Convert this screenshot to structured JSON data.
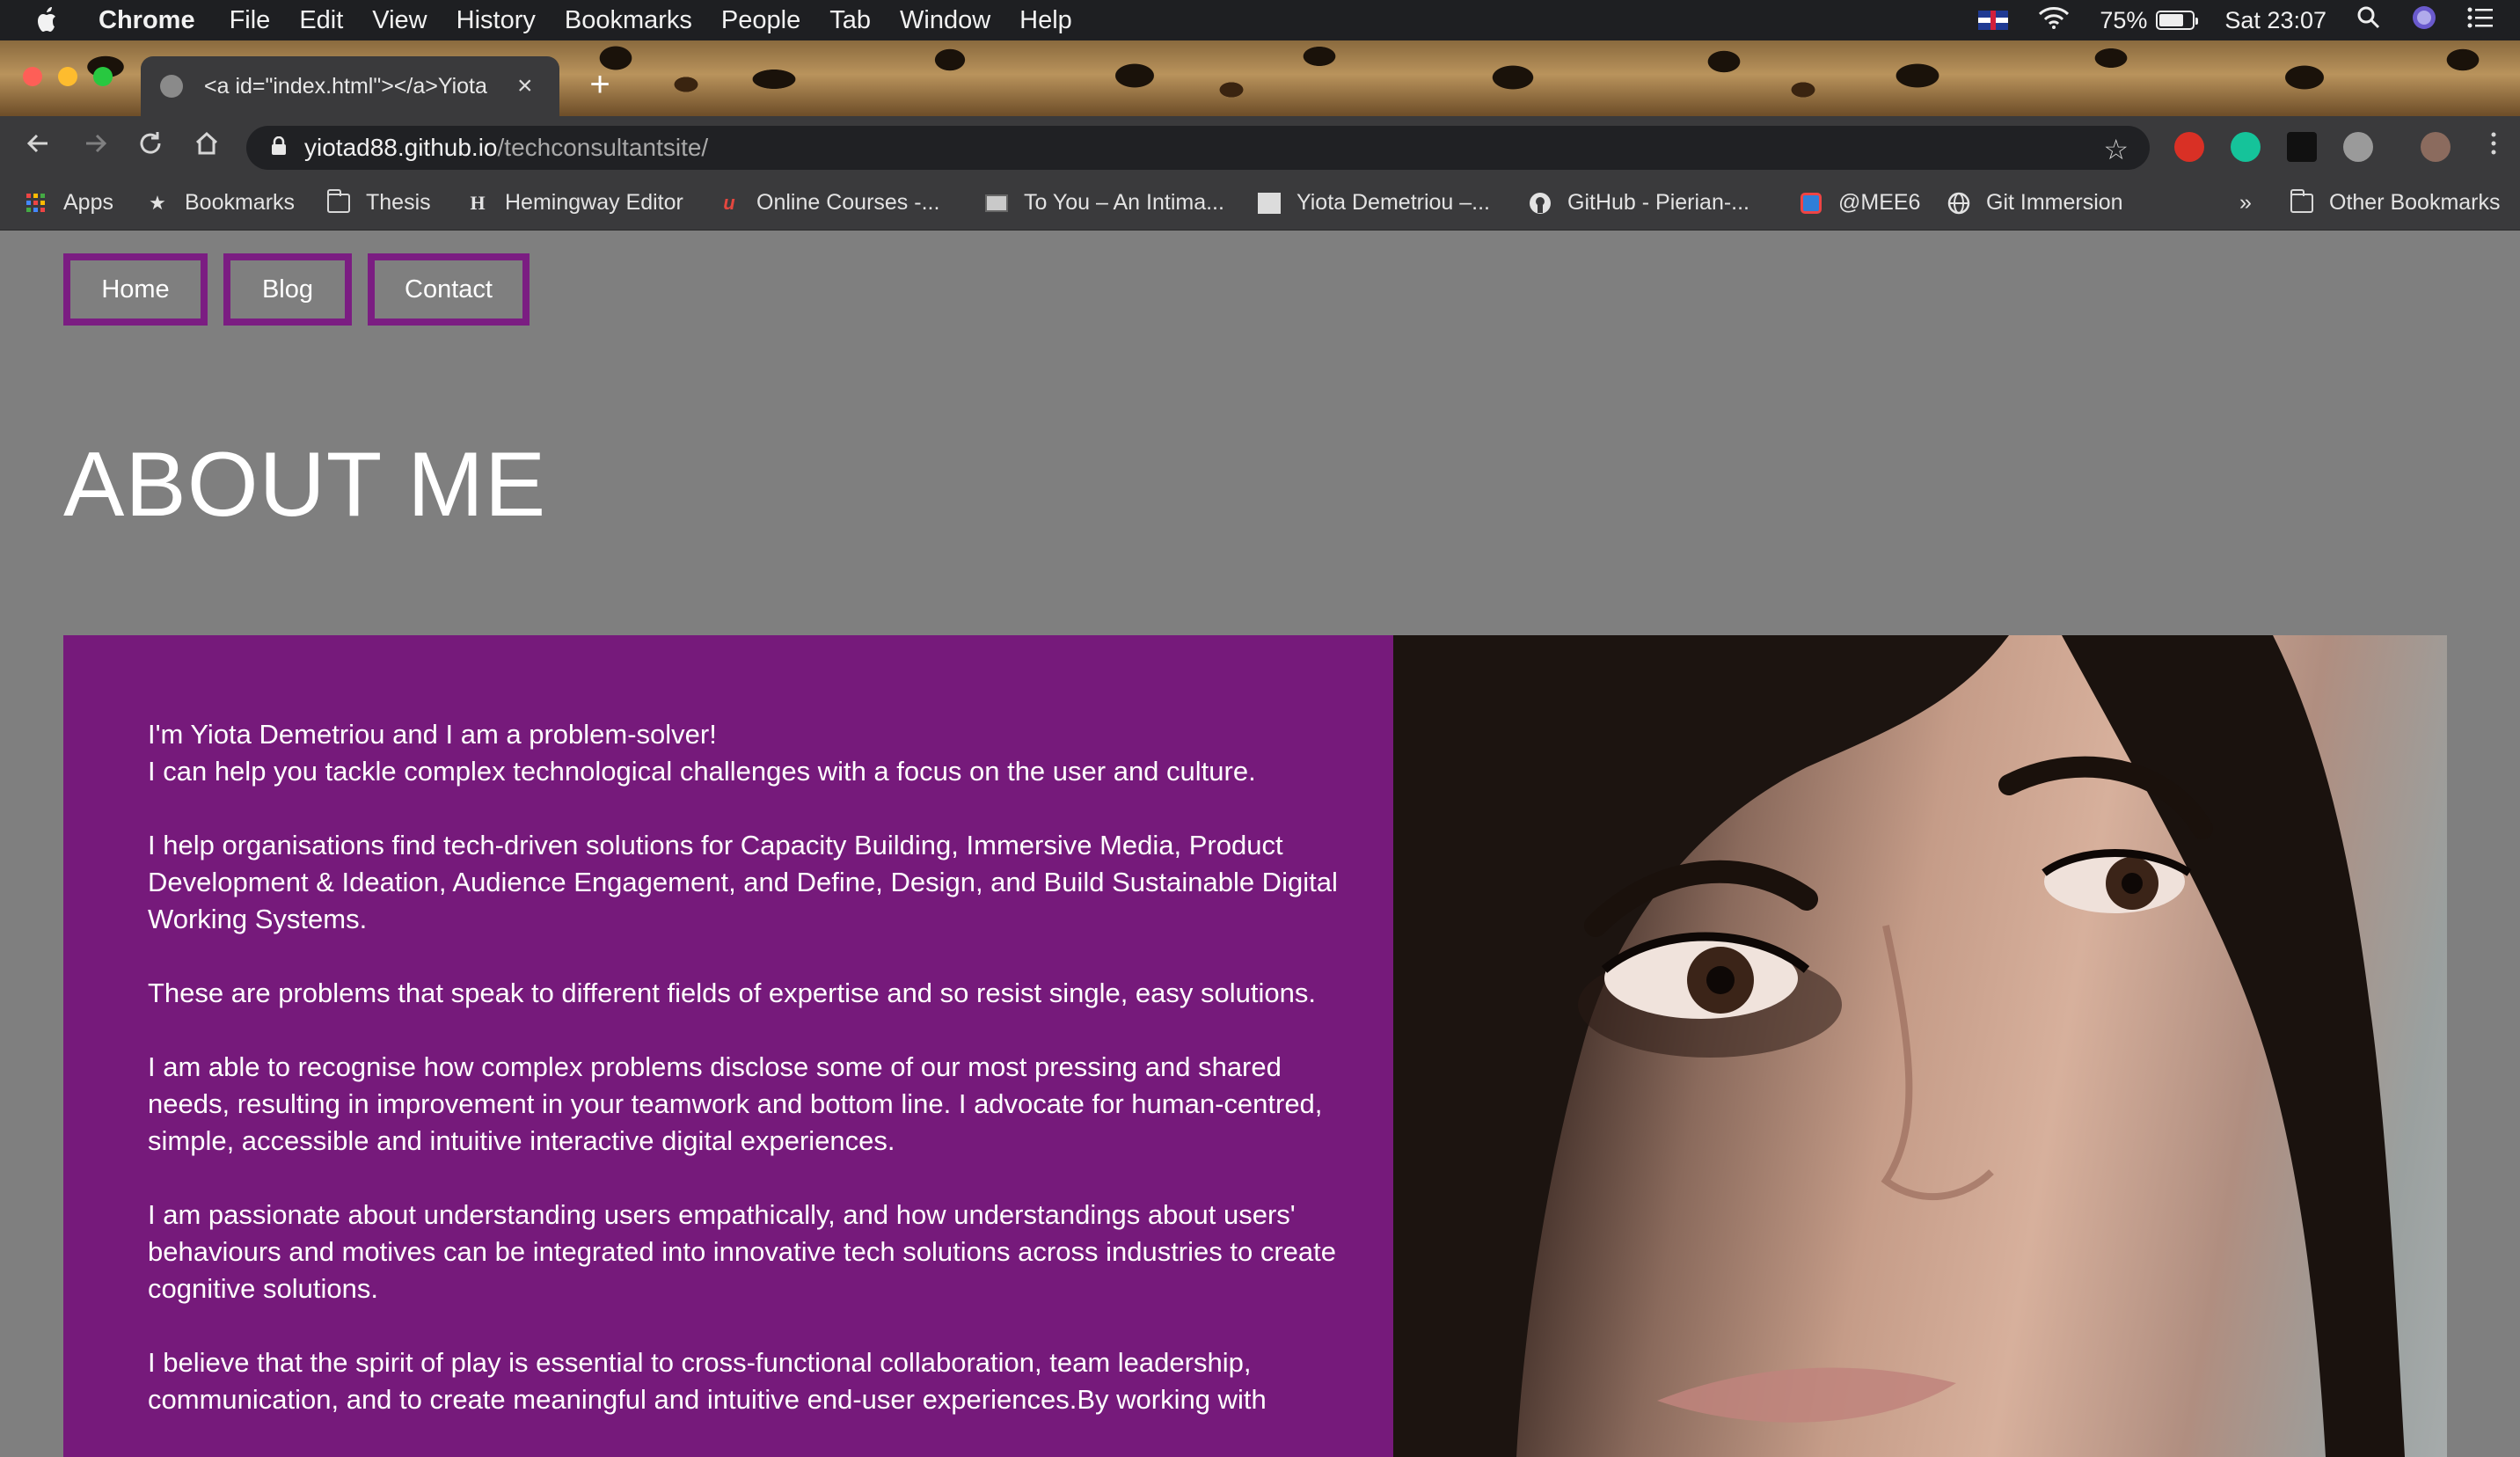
{
  "menubar": {
    "app_name": "Chrome",
    "items": [
      "File",
      "Edit",
      "View",
      "History",
      "Bookmarks",
      "People",
      "Tab",
      "Window",
      "Help"
    ],
    "battery": "75%",
    "battery_level": 0.75,
    "clock": "Sat 23:07"
  },
  "tab": {
    "title": "<a id=\"index.html\"></a>Yiota",
    "close": "×",
    "new_tab": "+"
  },
  "address_bar": {
    "host": "yiotad88.github.io",
    "path": "/techconsultantsite/"
  },
  "bookmarks": {
    "items": [
      "Apps",
      "Bookmarks",
      "Thesis",
      "Hemingway Editor",
      "Online Courses -...",
      "To You – An Intima...",
      "Yiota Demetriou –...",
      "GitHub - Pierian-...",
      "@MEE6",
      "Git Immersion"
    ],
    "overflow": "»",
    "other": "Other Bookmarks"
  },
  "page": {
    "nav": {
      "home": "Home",
      "blog": "Blog",
      "contact": "Contact"
    },
    "title": "ABOUT ME",
    "paragraphs": [
      {
        "line1": "I'm Yiota Demetriou and I am a problem-solver!",
        "line2": "I can help you tackle complex technological challenges with a focus on the user and culture."
      },
      {
        "text": "I help organisations find tech-driven solutions for Capacity Building, Immersive Media, Product Development & Ideation, Audience Engagement, and Define, Design, and Build Sustainable Digital Working Systems."
      },
      {
        "text": "These are problems that speak to different fields of expertise and so resist single, easy solutions."
      },
      {
        "text": "I am able to recognise how complex problems disclose some of our most pressing and shared needs, resulting in improvement in your teamwork and bottom line. I advocate for human-centred, simple, accessible and intuitive interactive digital experiences."
      },
      {
        "text": "I am passionate about understanding users empathically, and how understandings about users' behaviours and motives can be integrated into innovative tech solutions across industries to create cognitive solutions."
      },
      {
        "text": "I believe that the spirit of play is essential to cross-functional collaboration, team leadership, communication, and to create meaningful and intuitive end-user experiences.By working with"
      }
    ]
  },
  "colors": {
    "page_bg": "#7f7f7f",
    "accent_purple": "#761a7b",
    "nav_border": "#7b1d82"
  }
}
